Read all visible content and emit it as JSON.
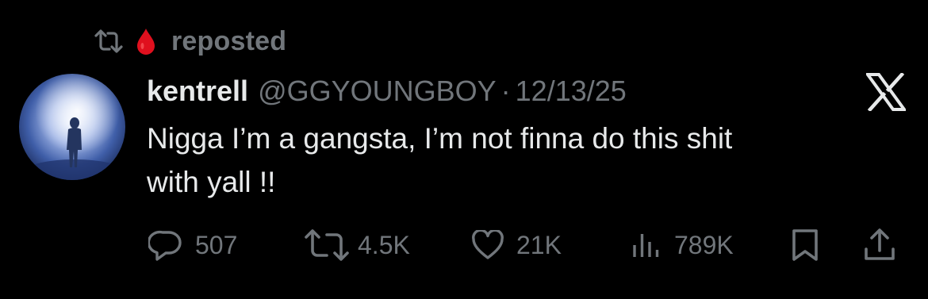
{
  "repost": {
    "label": "reposted",
    "icons": [
      "repost-icon",
      "blood-drop-icon"
    ]
  },
  "tweet": {
    "display_name": "kentrell",
    "handle": "@GGYOUNGBOY",
    "separator": "·",
    "date": "12/13/25",
    "text_lines": [
      "Nigga I’m a gangsta, I’m not finna do this shit",
      "with yall !!"
    ],
    "avatar_icon": "avatar-silhouette"
  },
  "actions": {
    "replies": "507",
    "reposts": "4.5K",
    "likes": "21K",
    "views": "789K",
    "icons": [
      "reply-icon",
      "repost-icon",
      "heart-icon",
      "views-icon",
      "bookmark-icon",
      "share-icon"
    ]
  },
  "brand": {
    "logo": "x-logo-icon"
  },
  "colors": {
    "background": "#000000",
    "primary_text": "#e7e9ea",
    "secondary_text": "#71767b",
    "blood_drop": "#e0101e"
  }
}
